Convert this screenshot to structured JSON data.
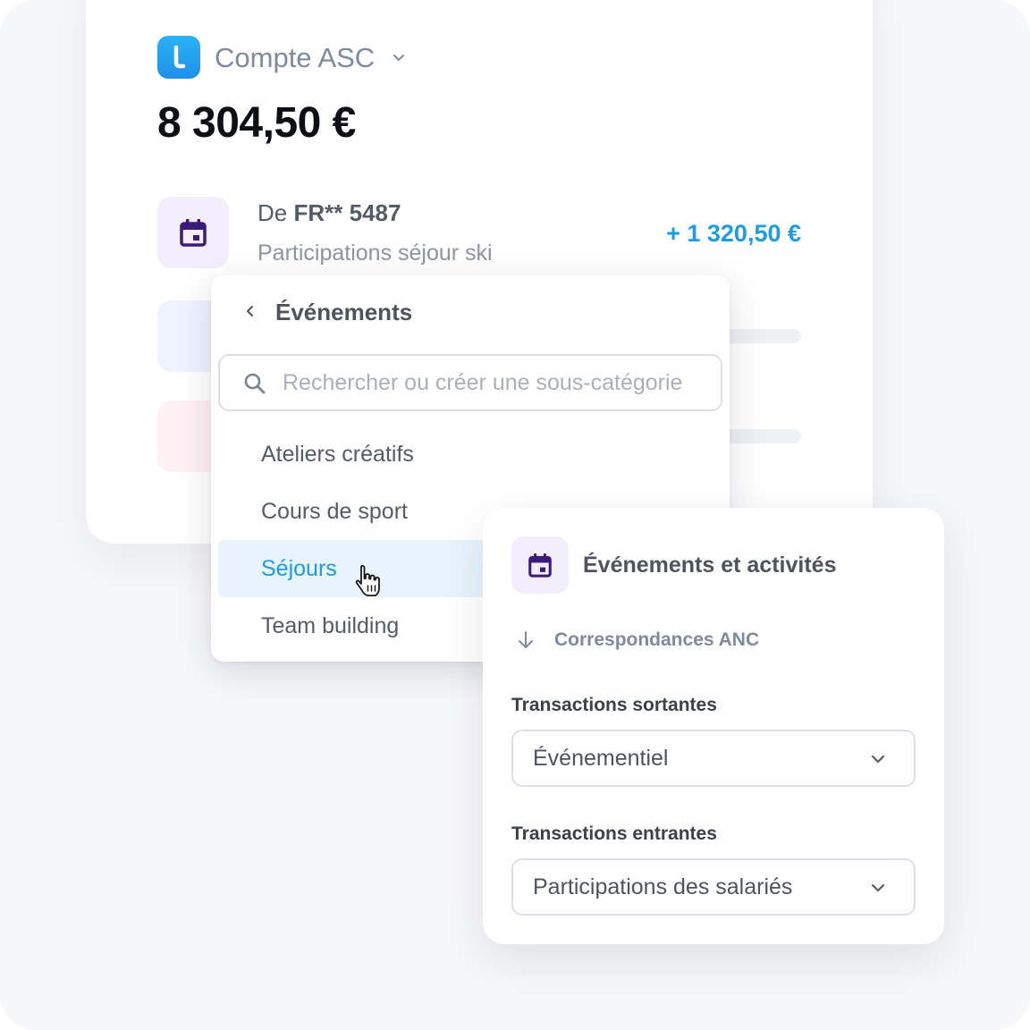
{
  "colors": {
    "brand_blue": "#1d9be5",
    "event_icon_purple": "#3b1a7a",
    "event_icon_bg": "#f3eefd",
    "selected_row_bg": "#e7f4fd"
  },
  "account": {
    "logo_icon": "app-logo-l",
    "name": "Compte ASC",
    "balance": "8 304,50 €"
  },
  "transaction": {
    "icon": "calendar-icon",
    "from_prefix": "De",
    "from_account": "FR** 5487",
    "label": "Participations séjour ski",
    "amount": "+ 1 320,50 €"
  },
  "category_dropdown": {
    "title": "Événements",
    "search_placeholder": "Rechercher ou créer une sous-catégorie",
    "items": [
      {
        "label": "Ateliers créatifs",
        "selected": false
      },
      {
        "label": "Cours de sport",
        "selected": false
      },
      {
        "label": "Séjours",
        "selected": true
      },
      {
        "label": "Team building",
        "selected": false
      }
    ]
  },
  "category_detail": {
    "icon": "calendar-icon",
    "title": "Événements et activités",
    "mapping_link": "Correspondances ANC",
    "outgoing": {
      "label": "Transactions sortantes",
      "value": "Événementiel"
    },
    "incoming": {
      "label": "Transactions entrantes",
      "value": "Participations des salariés"
    }
  }
}
